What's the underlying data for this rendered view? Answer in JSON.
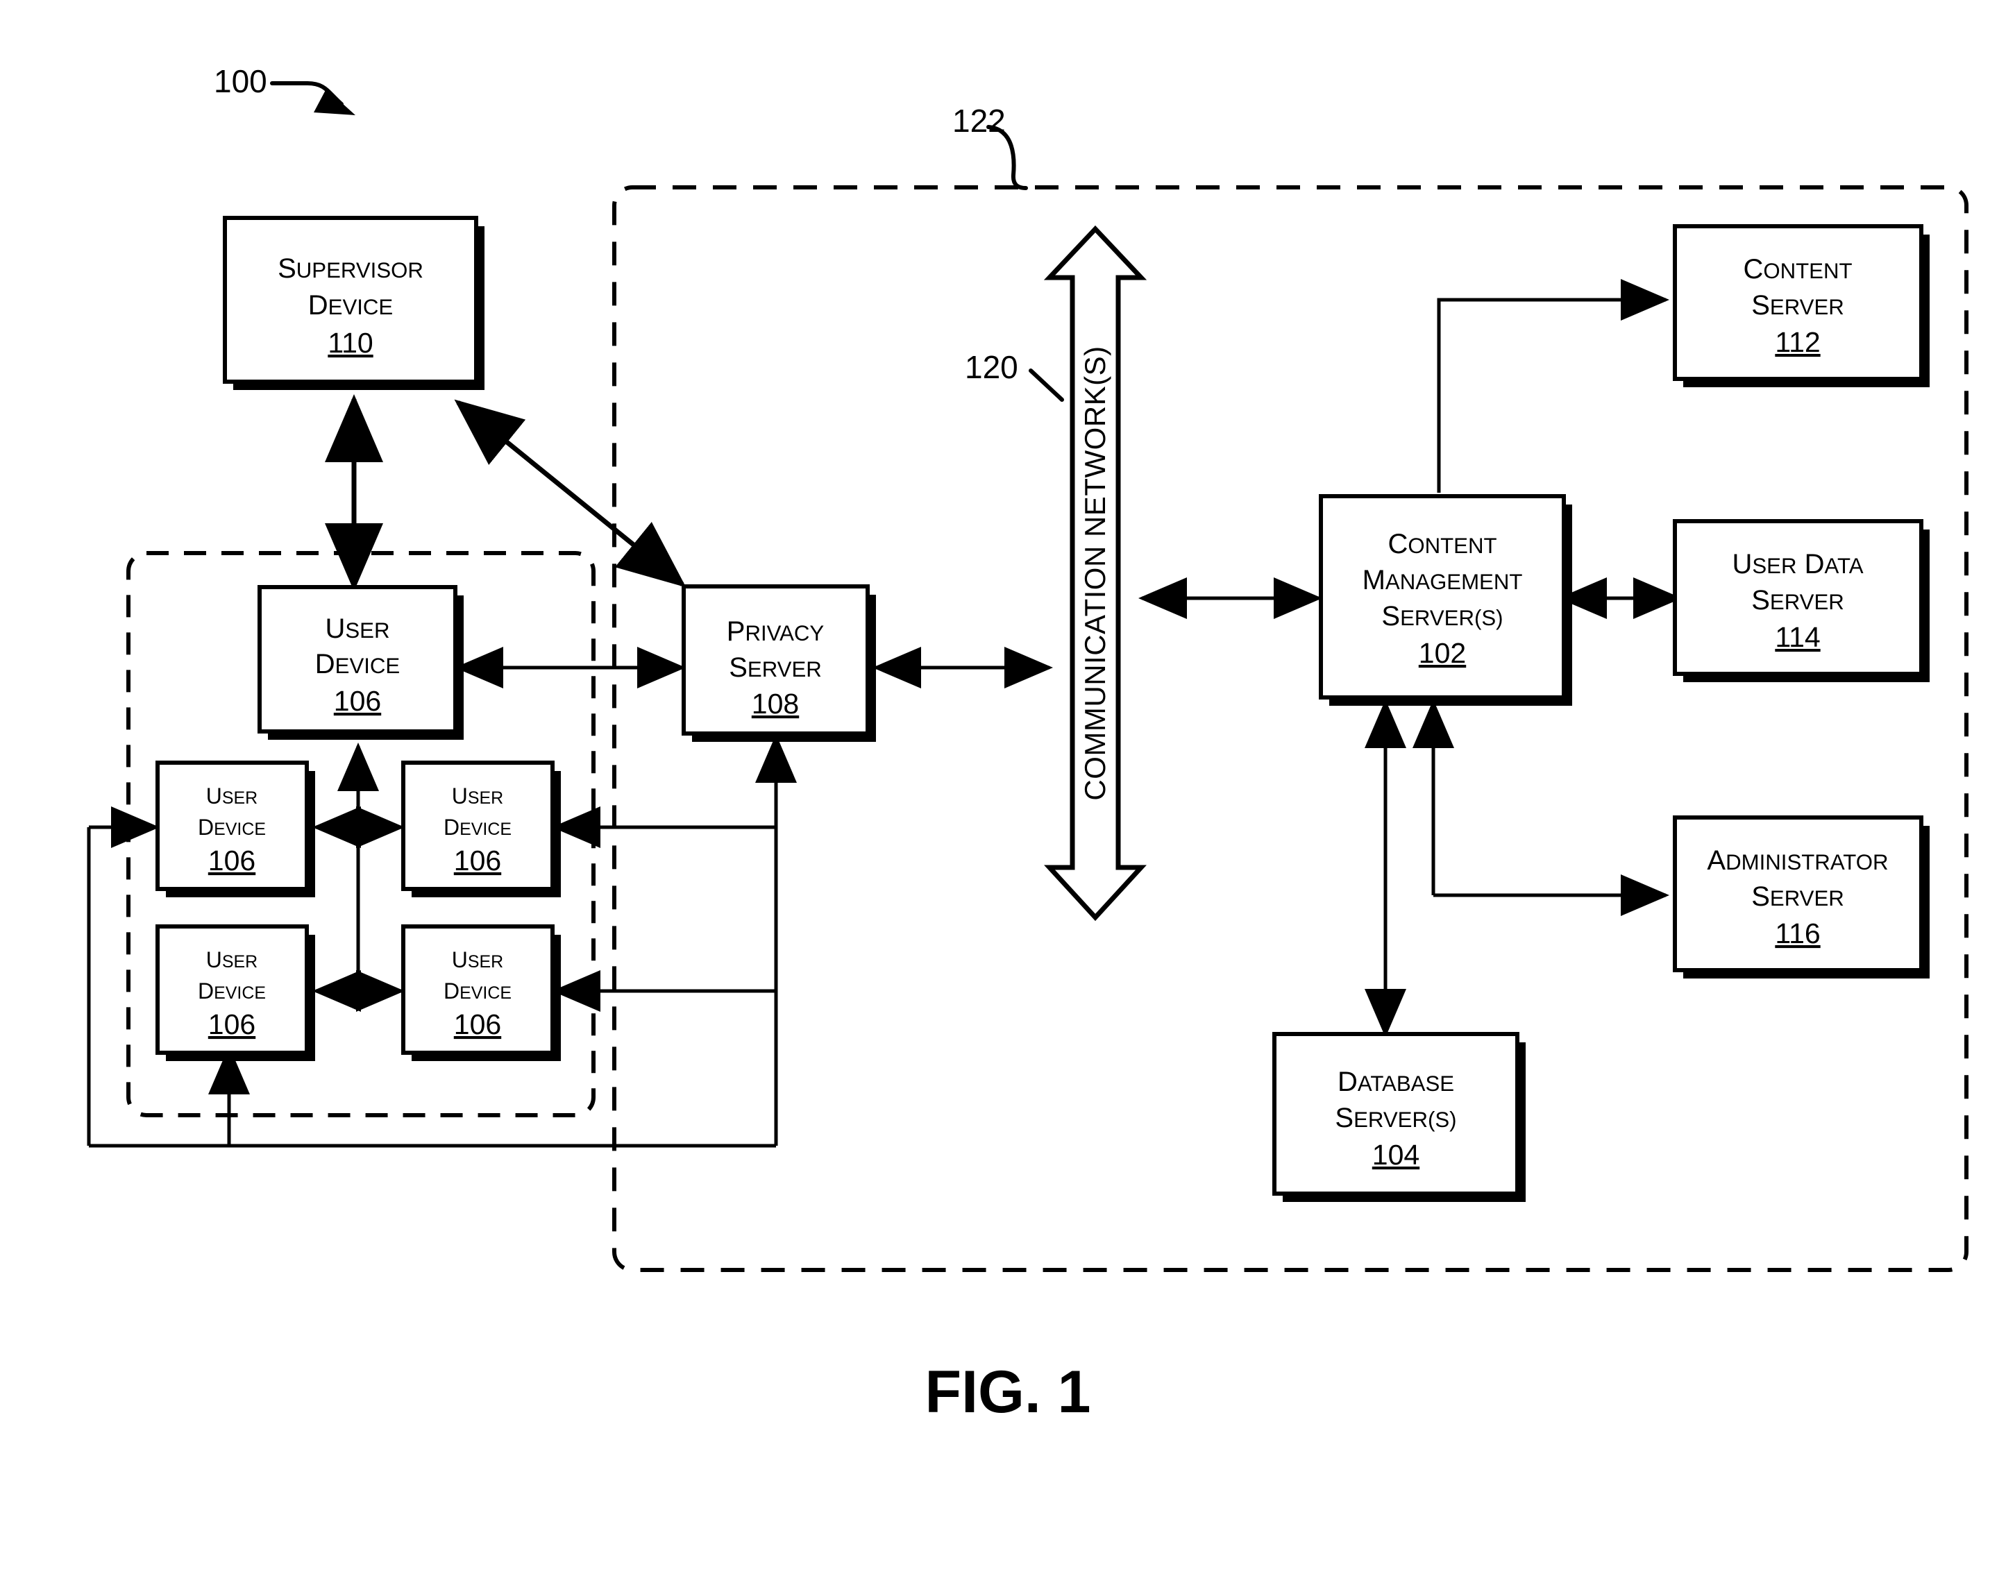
{
  "figure": {
    "caption": "FIG. 1",
    "system_ref": "100",
    "network_region_ref": "122",
    "network_ref": "120",
    "network_label": "COMMUNICATION NETWORK(S)"
  },
  "nodes": {
    "supervisor_device": {
      "line1": "SUPERVISOR",
      "line2": "DEVICE",
      "ref": "110"
    },
    "user_device_top": {
      "line1": "USER",
      "line2": "DEVICE",
      "ref": "106"
    },
    "user_device_ml": {
      "line1": "USER",
      "line2": "DEVICE",
      "ref": "106"
    },
    "user_device_mr": {
      "line1": "USER",
      "line2": "DEVICE",
      "ref": "106"
    },
    "user_device_bl": {
      "line1": "USER",
      "line2": "DEVICE",
      "ref": "106"
    },
    "user_device_br": {
      "line1": "USER",
      "line2": "DEVICE",
      "ref": "106"
    },
    "privacy_server": {
      "line1": "PRIVACY",
      "line2": "SERVER",
      "ref": "108"
    },
    "content_management_server": {
      "line1": "CONTENT",
      "line2": "MANAGEMENT",
      "line3": "SERVER(S)",
      "ref": "102"
    },
    "content_server": {
      "line1": "CONTENT",
      "line2": "SERVER",
      "ref": "112"
    },
    "user_data_server": {
      "line1": "USER DATA",
      "line2": "SERVER",
      "ref": "114"
    },
    "administrator_server": {
      "line1": "ADMINISTRATOR",
      "line2": "SERVER",
      "ref": "116"
    },
    "database_server": {
      "line1": "DATABASE",
      "line2": "SERVER(S)",
      "ref": "104"
    }
  },
  "colors": {
    "ink": "#000000",
    "paper": "#ffffff"
  }
}
